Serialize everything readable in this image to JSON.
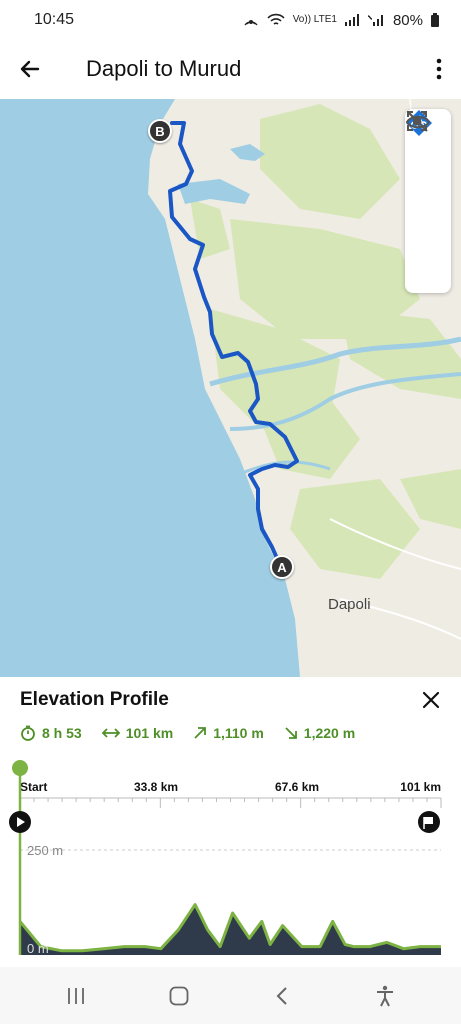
{
  "status": {
    "time": "10:45",
    "network": "Vo)) LTE1",
    "battery": "80%"
  },
  "header": {
    "title": "Dapoli to Murud"
  },
  "map": {
    "place_label": "Dapoli",
    "start_marker": "A",
    "end_marker": "B",
    "controls": [
      "location-arrow-icon",
      "bike-route-icon",
      "focus-frame-icon",
      "hide-eye-icon"
    ],
    "colors": {
      "route": "#1a56c4",
      "water": "#9fcde3",
      "land": "#efece4",
      "forest": "#d7e6b6"
    }
  },
  "elevation": {
    "title": "Elevation Profile",
    "duration": "8 h 53",
    "distance": "101 km",
    "ascent": "1,110 m",
    "descent": "1,220 m",
    "x_labels": [
      "Start",
      "33.8 km",
      "67.6 km",
      "101 km"
    ],
    "y_labels": [
      "250 m",
      "0 m"
    ],
    "colors": {
      "accent": "#4e8f27",
      "line": "#7cb342",
      "fill": "#2f3a4a"
    }
  },
  "chart_data": {
    "type": "area",
    "x": [
      0,
      5,
      10,
      15,
      20,
      25,
      30,
      33.8,
      38,
      42,
      45,
      48,
      51,
      55,
      58,
      60,
      63,
      67.6,
      72,
      75,
      78,
      80,
      84,
      88,
      92,
      96,
      101
    ],
    "y": [
      80,
      20,
      10,
      10,
      15,
      20,
      20,
      15,
      60,
      120,
      60,
      20,
      100,
      40,
      80,
      25,
      70,
      20,
      20,
      80,
      25,
      20,
      20,
      30,
      15,
      20,
      20
    ],
    "ylabel": "",
    "xlim": [
      0,
      101
    ],
    "ylim": [
      0,
      250
    ]
  },
  "nav": {
    "buttons": [
      "recent-apps-icon",
      "home-icon",
      "back-nav-icon",
      "accessibility-icon"
    ]
  }
}
